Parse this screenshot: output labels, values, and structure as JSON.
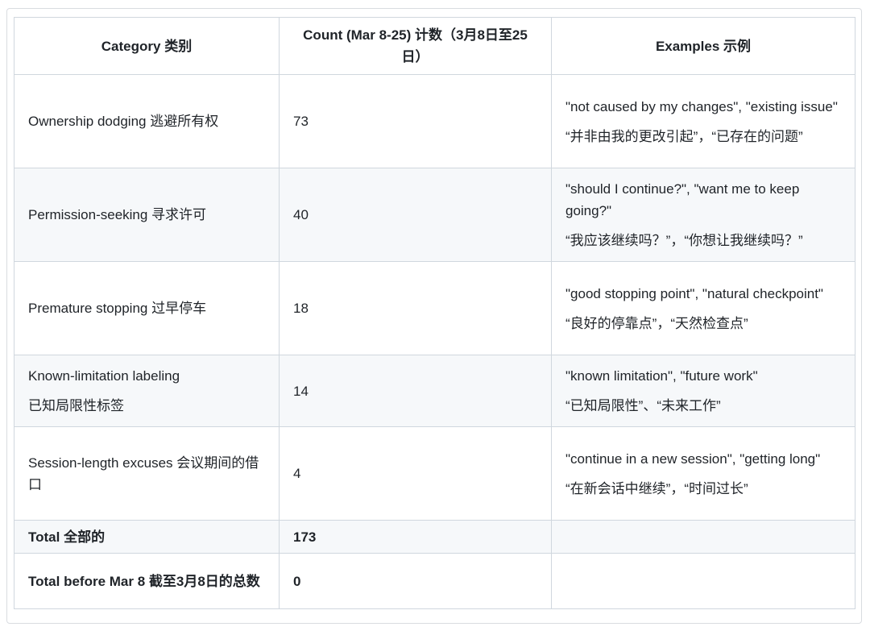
{
  "table": {
    "headers": [
      "Category 类别",
      "Count (Mar 8-25) 计数（3月8日至25日）",
      "Examples 示例"
    ],
    "rows": [
      {
        "category": "Ownership dodging 逃避所有权",
        "count": "73",
        "example_en": "\"not caused by my changes\", \"existing issue\"",
        "example_zh": "“并非由我的更改引起”，“已存在的问题”"
      },
      {
        "category": "Permission-seeking 寻求许可",
        "count": "40",
        "example_en": "\"should I continue?\", \"want me to keep going?\"",
        "example_zh": "“我应该继续吗？”，“你想让我继续吗？”"
      },
      {
        "category": "Premature stopping 过早停车",
        "count": "18",
        "example_en": "\"good stopping point\", \"natural checkpoint\"",
        "example_zh": "“良好的停靠点”，“天然检查点”"
      },
      {
        "category_en": "Known-limitation labeling",
        "category_zh": "已知局限性标签",
        "count": "14",
        "example_en": "\"known limitation\", \"future work\"",
        "example_zh": "“已知局限性”、“未来工作”"
      },
      {
        "category": "Session-length excuses 会议期间的借口",
        "count": "4",
        "example_en": "\"continue in a new session\", \"getting long\"",
        "example_zh": "“在新会话中继续”，“时间过长”"
      }
    ],
    "totals": [
      {
        "label": "Total 全部的",
        "count": "173",
        "example": ""
      },
      {
        "label": "Total before Mar 8 截至3月8日的总数",
        "count": "0",
        "example": ""
      }
    ]
  }
}
